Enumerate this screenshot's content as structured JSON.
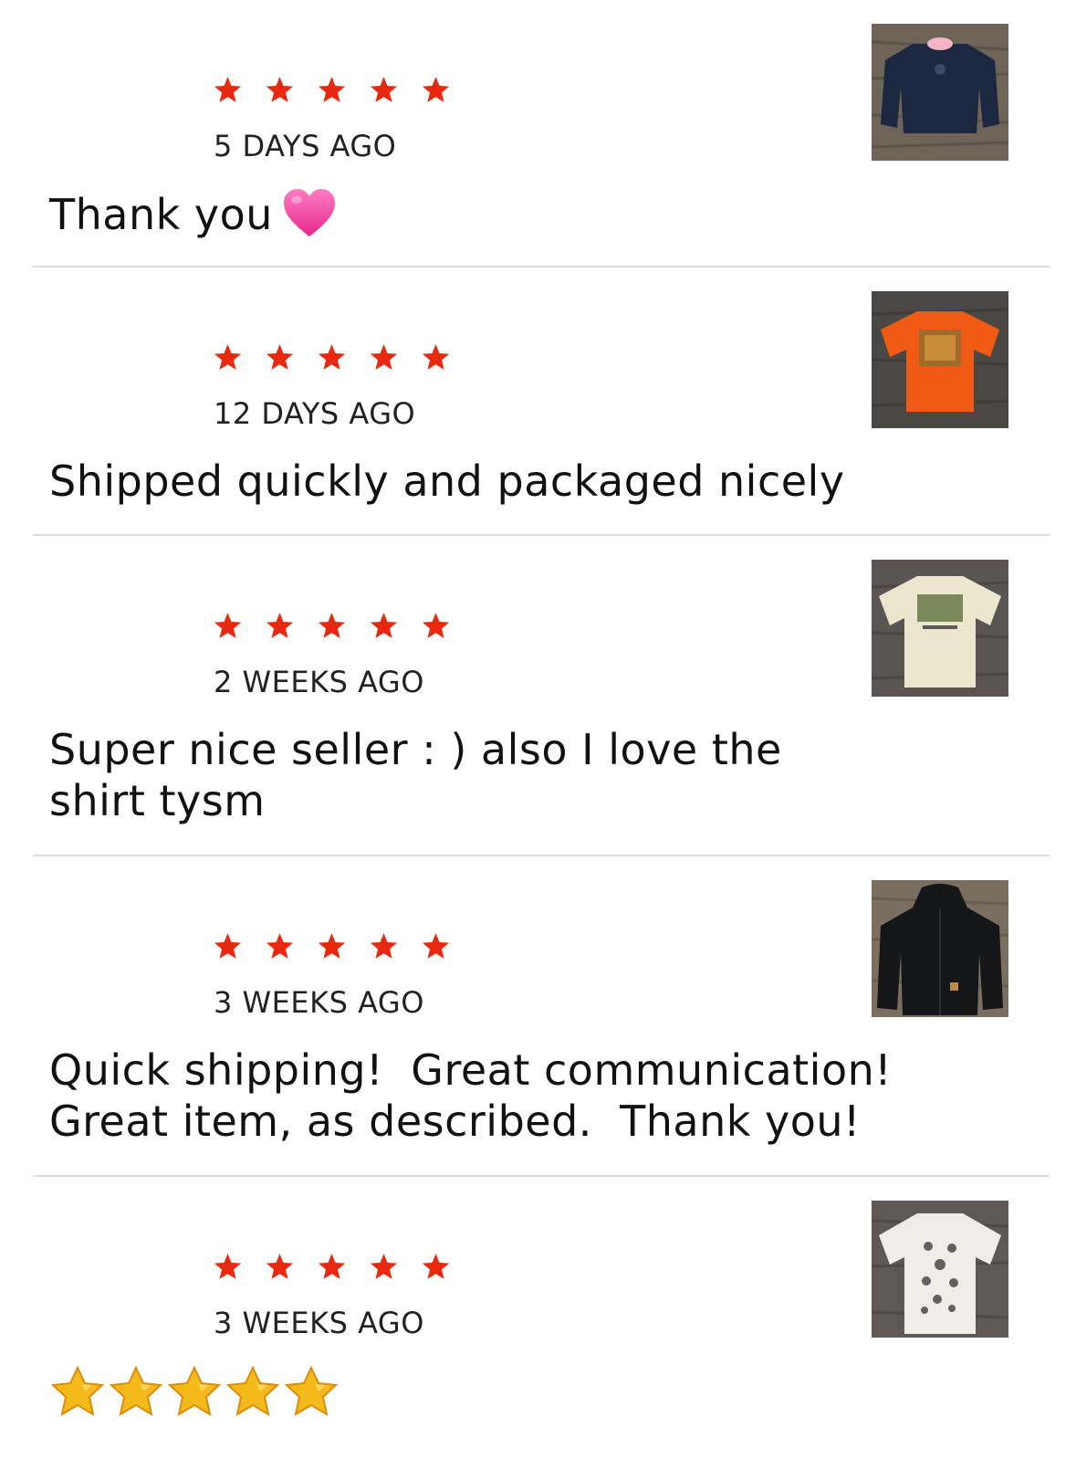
{
  "colors": {
    "star": "#e8290f",
    "divider": "#dcdcdc",
    "gold_star": "#f5b91a",
    "heart": "#f25aa8"
  },
  "reviews": [
    {
      "rating": 5,
      "time": "5 DAYS AGO",
      "comment": "Thank you",
      "emoji": "heart-emoji",
      "thumb_icon": "navy-sweatshirt-photo"
    },
    {
      "rating": 5,
      "time": "12 DAYS AGO",
      "comment": "Shipped quickly and packaged nicely",
      "thumb_icon": "orange-tshirt-photo"
    },
    {
      "rating": 5,
      "time": "2 WEEKS AGO",
      "comment": "Super nice seller : ) also I love the shirt tysm",
      "thumb_icon": "cream-tshirt-photo"
    },
    {
      "rating": 5,
      "time": "3 WEEKS AGO",
      "comment": "Quick shipping!  Great communication!  Great item, as described.  Thank you!",
      "thumb_icon": "black-hoodie-photo"
    },
    {
      "rating": 5,
      "time": "3 WEEKS AGO",
      "comment": "",
      "emoji": "five-gold-star-emojis",
      "thumb_icon": "white-tshirt-photo"
    }
  ]
}
